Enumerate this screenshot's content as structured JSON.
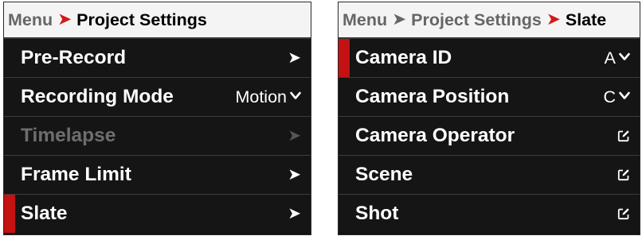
{
  "left": {
    "breadcrumb": {
      "root": "Menu",
      "current": "Project Settings"
    },
    "items": [
      {
        "label": "Pre-Record"
      },
      {
        "label": "Recording Mode",
        "value": "Motion"
      },
      {
        "label": "Timelapse"
      },
      {
        "label": "Frame Limit"
      },
      {
        "label": "Slate"
      }
    ]
  },
  "right": {
    "breadcrumb": {
      "root": "Menu",
      "middle": "Project Settings",
      "current": "Slate"
    },
    "items": [
      {
        "label": "Camera ID",
        "value": "A"
      },
      {
        "label": "Camera Position",
        "value": "C"
      },
      {
        "label": "Camera Operator"
      },
      {
        "label": "Scene"
      },
      {
        "label": "Shot"
      }
    ]
  },
  "icons": {
    "chevron_right": "chevron-right-icon",
    "dropdown": "chevron-down-icon",
    "edit": "edit-icon"
  },
  "colors": {
    "accent": "#c41212",
    "crumb_arrow": "#d11a1a",
    "background": "#111111"
  }
}
